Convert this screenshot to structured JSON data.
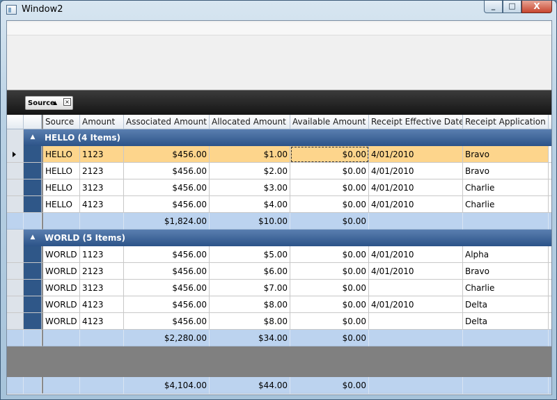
{
  "window": {
    "title": "Window2"
  },
  "caption_buttons": {
    "minimize": "_",
    "maximize": "□",
    "close": "X"
  },
  "group_panel": {
    "chip_label": "Source",
    "sort": "▲",
    "remove": "×"
  },
  "columns": [
    "Source",
    "Amount",
    "Associated Amount",
    "Allocated Amount",
    "Available Amount",
    "Receipt Effective Date",
    "Receipt Application"
  ],
  "groups": [
    {
      "title": "HELLO (4 Items)",
      "rows": [
        {
          "source": "HELLO",
          "amount": "1123",
          "associated": "$456.00",
          "allocated": "$1.00",
          "available": "$0.00",
          "date": "4/01/2010",
          "application": "Bravo"
        },
        {
          "source": "HELLO",
          "amount": "2123",
          "associated": "$456.00",
          "allocated": "$2.00",
          "available": "$0.00",
          "date": "4/01/2010",
          "application": "Bravo"
        },
        {
          "source": "HELLO",
          "amount": "3123",
          "associated": "$456.00",
          "allocated": "$3.00",
          "available": "$0.00",
          "date": "4/01/2010",
          "application": "Charlie"
        },
        {
          "source": "HELLO",
          "amount": "4123",
          "associated": "$456.00",
          "allocated": "$4.00",
          "available": "$0.00",
          "date": "4/01/2010",
          "application": "Charlie"
        }
      ],
      "summary": {
        "associated": "$1,824.00",
        "allocated": "$10.00",
        "available": "$0.00"
      }
    },
    {
      "title": "WORLD (5 Items)",
      "rows": [
        {
          "source": "WORLD",
          "amount": "1123",
          "associated": "$456.00",
          "allocated": "$5.00",
          "available": "$0.00",
          "date": "4/01/2010",
          "application": "Alpha"
        },
        {
          "source": "WORLD",
          "amount": "2123",
          "associated": "$456.00",
          "allocated": "$6.00",
          "available": "$0.00",
          "date": "4/01/2010",
          "application": "Bravo"
        },
        {
          "source": "WORLD",
          "amount": "3123",
          "associated": "$456.00",
          "allocated": "$7.00",
          "available": "$0.00",
          "date": "",
          "application": "Charlie"
        },
        {
          "source": "WORLD",
          "amount": "4123",
          "associated": "$456.00",
          "allocated": "$8.00",
          "available": "$0.00",
          "date": "4/01/2010",
          "application": "Delta"
        },
        {
          "source": "WORLD",
          "amount": "4123",
          "associated": "$456.00",
          "allocated": "$8.00",
          "available": "$0.00",
          "date": "",
          "application": "Delta"
        }
      ],
      "summary": {
        "associated": "$2,280.00",
        "allocated": "$34.00",
        "available": "$0.00"
      }
    }
  ],
  "grand_total": {
    "associated": "$4,104.00",
    "allocated": "$44.00",
    "available": "$0.00"
  },
  "colors": {
    "group_header": "#2c5388",
    "selected_row": "#fdd58c",
    "summary_row": "#bcd3ef",
    "filler": "#808080"
  }
}
